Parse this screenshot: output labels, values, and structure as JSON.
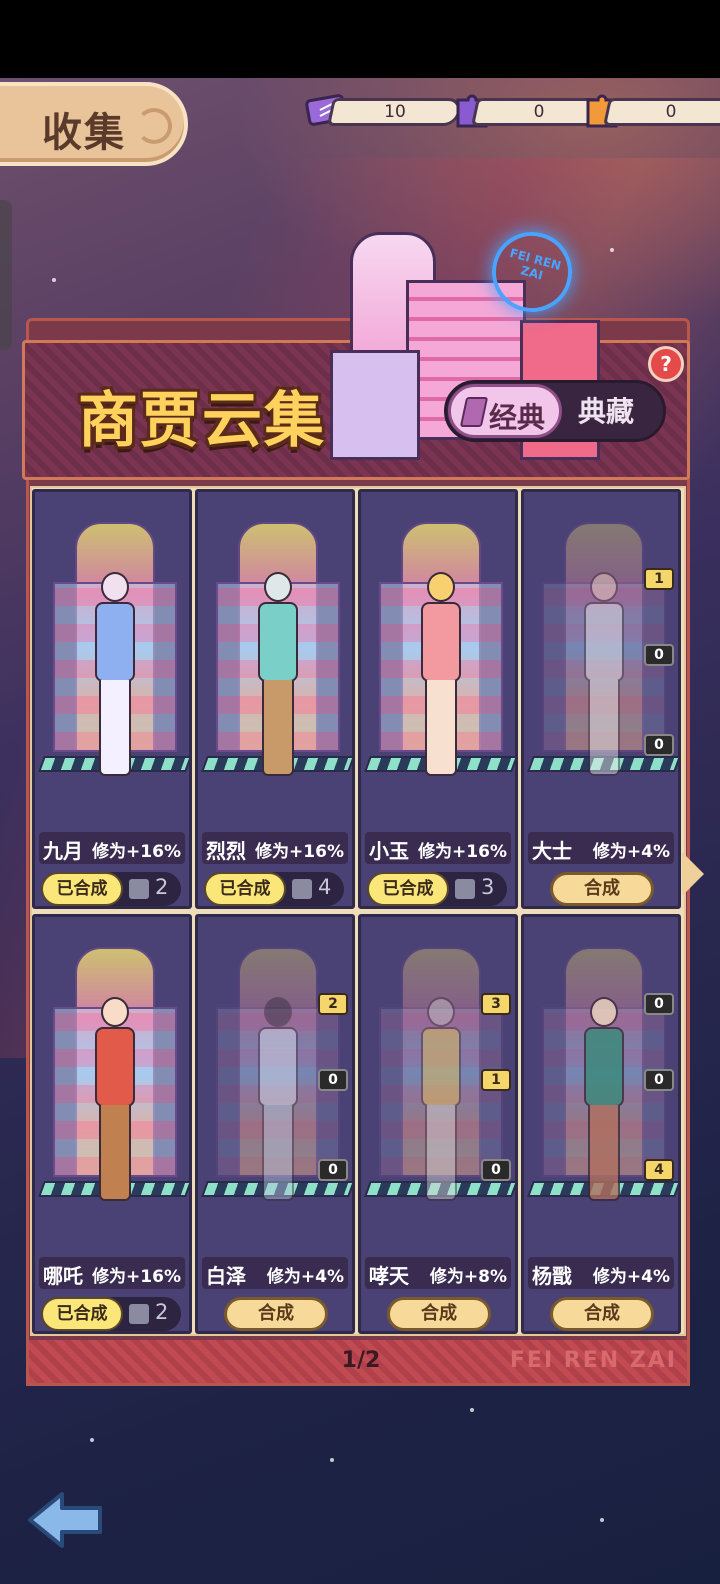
{
  "title": "收集",
  "currencies": [
    {
      "icon": "ticket-icon",
      "value": "10",
      "color": "#9a6bd8"
    },
    {
      "icon": "purple-puzzle-icon",
      "value": "0",
      "color": "#8a5ad0"
    },
    {
      "icon": "orange-puzzle-icon",
      "value": "0",
      "color": "#f29a3a"
    }
  ],
  "banner": {
    "title": "商贾云集",
    "sign_text": "FEI REN ZAI",
    "toggle_active": "经典",
    "toggle_inactive": "典藏",
    "help": "?"
  },
  "cards": [
    {
      "name": "九月",
      "bonus": "修为+16%",
      "state": "done",
      "done_label": "已合成",
      "pieces": "2",
      "outfit": "#8fb0f0",
      "badges": []
    },
    {
      "name": "烈烈",
      "bonus": "修为+16%",
      "state": "done",
      "done_label": "已合成",
      "pieces": "4",
      "outfit": "#7ad0c8",
      "badges": []
    },
    {
      "name": "小玉",
      "bonus": "修为+16%",
      "state": "done",
      "done_label": "已合成",
      "pieces": "3",
      "outfit": "#f29aa0",
      "badges": []
    },
    {
      "name": "大士",
      "bonus": "修为+4%",
      "state": "todo",
      "button_label": "合成",
      "outfit": "#f0f0f0",
      "badges": [
        {
          "v": "1",
          "gold": true
        },
        {
          "v": "0",
          "gold": false
        },
        {
          "v": "0",
          "gold": false
        }
      ]
    },
    {
      "name": "哪吒",
      "bonus": "修为+16%",
      "state": "done",
      "done_label": "已合成",
      "pieces": "2",
      "outfit": "#e25a4a",
      "badges": []
    },
    {
      "name": "白泽",
      "bonus": "修为+4%",
      "state": "todo",
      "button_label": "合成",
      "outfit": "#dfe8f5",
      "badges": [
        {
          "v": "2",
          "gold": true
        },
        {
          "v": "0",
          "gold": false
        },
        {
          "v": "0",
          "gold": false
        }
      ]
    },
    {
      "name": "哮天",
      "bonus": "修为+8%",
      "state": "todo",
      "button_label": "合成",
      "outfit": "#f0c850",
      "badges": [
        {
          "v": "3",
          "gold": true
        },
        {
          "v": "1",
          "gold": true
        },
        {
          "v": "0",
          "gold": false
        }
      ]
    },
    {
      "name": "杨戬",
      "bonus": "修为+4%",
      "state": "todo",
      "button_label": "合成",
      "outfit": "#3a8a7a",
      "badges": [
        {
          "v": "0",
          "gold": false
        },
        {
          "v": "0",
          "gold": false
        },
        {
          "v": "4",
          "gold": true
        }
      ]
    }
  ],
  "pagination": "1/2",
  "watermark": "FEI REN ZAI"
}
